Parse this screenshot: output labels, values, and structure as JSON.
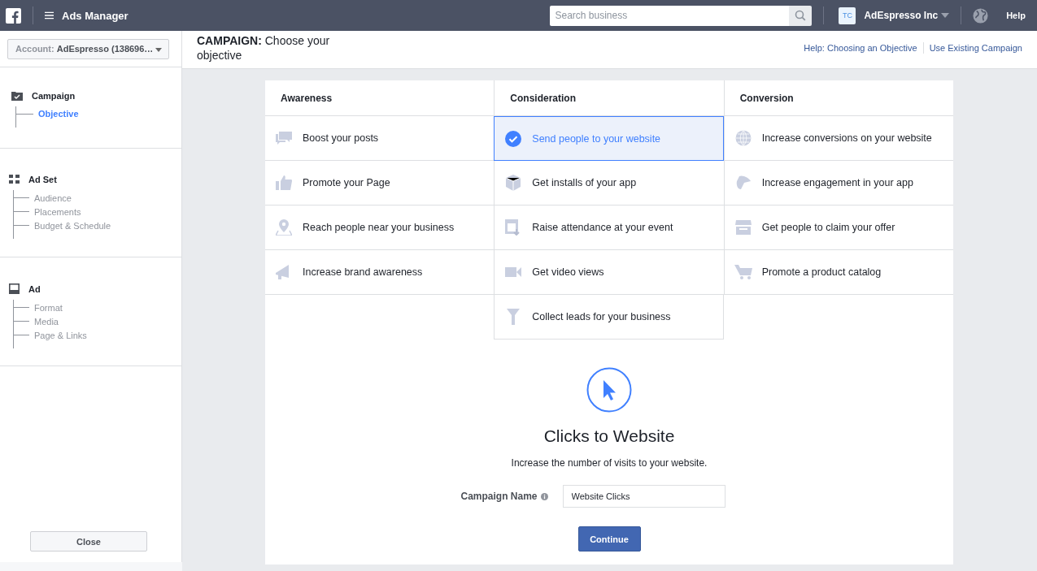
{
  "topbar": {
    "app_title": "Ads Manager",
    "search": {
      "placeholder": "Search business"
    },
    "account_initials": "TC",
    "account_name": "AdEspresso Inc",
    "help": "Help"
  },
  "sidebar": {
    "account_label": "Account:",
    "account_value": "AdEspresso (138696…",
    "sections": [
      {
        "title": "Campaign",
        "children": [
          {
            "label": "Objective",
            "selected": true
          }
        ]
      },
      {
        "title": "Ad Set",
        "children": [
          {
            "label": "Audience",
            "selected": false
          },
          {
            "label": "Placements",
            "selected": false
          },
          {
            "label": "Budget & Schedule",
            "selected": false
          }
        ]
      },
      {
        "title": "Ad",
        "children": [
          {
            "label": "Format",
            "selected": false
          },
          {
            "label": "Media",
            "selected": false
          },
          {
            "label": "Page & Links",
            "selected": false
          }
        ]
      }
    ],
    "close_button": "Close"
  },
  "header": {
    "title": "**CAMPAIGN:** Choose your objective",
    "links": [
      "Help: Choosing an Objective",
      "Use Existing Campaign"
    ]
  },
  "objectives": [
    {
      "heading": "Awareness",
      "items": [
        {
          "label": "Boost your posts",
          "selected": false
        },
        {
          "label": "Promote your Page",
          "selected": false
        },
        {
          "label": "Reach people near your business",
          "selected": false
        },
        {
          "label": "Increase brand awareness",
          "selected": false
        }
      ]
    },
    {
      "heading": "Consideration",
      "items": [
        {
          "label": "Send people to your website",
          "selected": true
        },
        {
          "label": "Get installs of your app",
          "selected": false
        },
        {
          "label": "Raise attendance at your event",
          "selected": false
        },
        {
          "label": "Get video views",
          "selected": false
        },
        {
          "label": "Collect leads for your business",
          "selected": false
        }
      ]
    },
    {
      "heading": "Conversion",
      "items": [
        {
          "label": "Increase conversions on your website",
          "selected": false
        },
        {
          "label": "Increase engagement in your app",
          "selected": false
        },
        {
          "label": "Get people to claim your offer",
          "selected": false
        },
        {
          "label": "Promote a product catalog",
          "selected": false
        }
      ]
    }
  ],
  "detail": {
    "title": "Clicks to Website",
    "description": "Increase the number of visits to your website.",
    "field_label": "Campaign Name",
    "field_value": "Website Clicks",
    "button": "Continue"
  }
}
